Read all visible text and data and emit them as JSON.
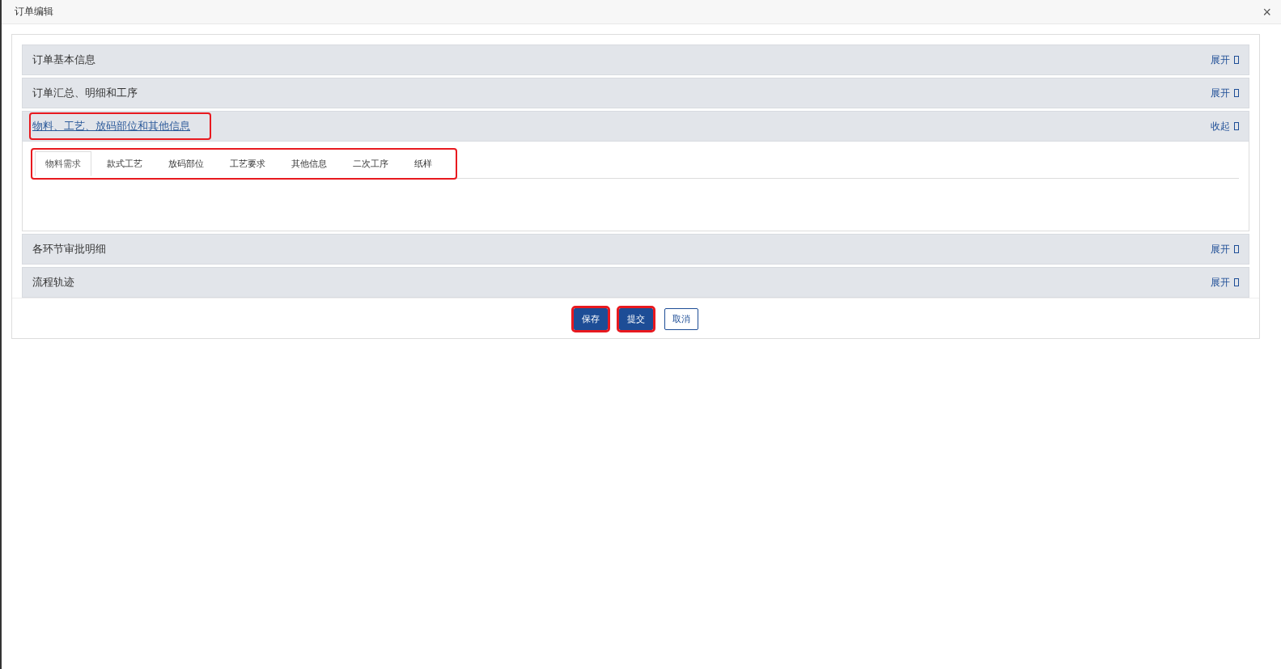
{
  "window": {
    "title": "订单编辑",
    "close": "×"
  },
  "sections": [
    {
      "title": "订单基本信息",
      "toggle": "展开",
      "expanded": false,
      "highlighted": false
    },
    {
      "title": "订单汇总、明细和工序",
      "toggle": "展开",
      "expanded": false,
      "highlighted": false
    },
    {
      "title": "物料、工艺、放码部位和其他信息",
      "toggle": "收起",
      "expanded": true,
      "highlighted": true,
      "tabs_highlighted": true,
      "tabs": [
        {
          "label": "物料需求",
          "selected": true
        },
        {
          "label": "款式工艺",
          "selected": false
        },
        {
          "label": "放码部位",
          "selected": false
        },
        {
          "label": "工艺要求",
          "selected": false
        },
        {
          "label": "其他信息",
          "selected": false
        },
        {
          "label": "二次工序",
          "selected": false
        },
        {
          "label": "纸样",
          "selected": false
        }
      ]
    },
    {
      "title": "各环节审批明细",
      "toggle": "展开",
      "expanded": false,
      "highlighted": false
    },
    {
      "title": "流程轨迹",
      "toggle": "展开",
      "expanded": false,
      "highlighted": false
    }
  ],
  "buttons": [
    {
      "label": "保存",
      "kind": "primary",
      "highlighted": true
    },
    {
      "label": "提交",
      "kind": "primary",
      "highlighted": true
    },
    {
      "label": "取消",
      "kind": "outline",
      "highlighted": false
    }
  ]
}
